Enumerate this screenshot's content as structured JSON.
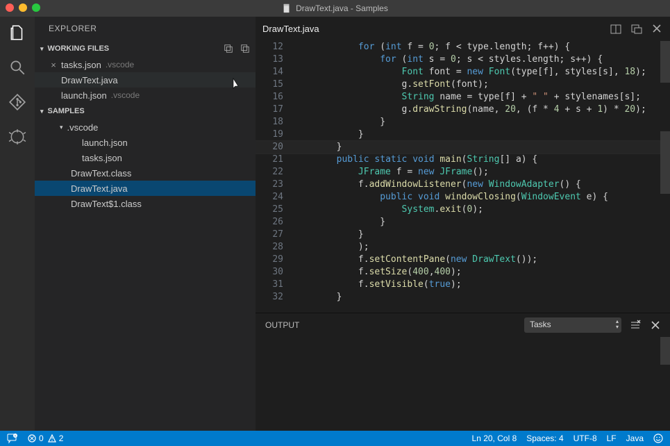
{
  "window": {
    "title": "DrawText.java - Samples"
  },
  "sidebar": {
    "title": "EXPLORER",
    "working_files_label": "WORKING FILES",
    "working_files": [
      {
        "name": "tasks.json",
        "meta": ".vscode",
        "close": true
      },
      {
        "name": "DrawText.java",
        "meta": "",
        "close": false
      },
      {
        "name": "launch.json",
        "meta": ".vscode",
        "close": false
      }
    ],
    "samples_label": "SAMPLES",
    "folder": ".vscode",
    "files_in_folder": [
      "launch.json",
      "tasks.json"
    ],
    "root_files": [
      "DrawText.class",
      "DrawText.java",
      "DrawText$1.class"
    ]
  },
  "editor": {
    "tab": "DrawText.java",
    "lines": [
      {
        "n": 12,
        "html": "            <span class='tok-kw'>for</span> (<span class='tok-kw'>int</span> f = <span class='tok-num'>0</span>; f &lt; type.length; f++) {"
      },
      {
        "n": 13,
        "html": "                <span class='tok-kw'>for</span> (<span class='tok-kw'>int</span> s = <span class='tok-num'>0</span>; s &lt; styles.length; s++) {"
      },
      {
        "n": 14,
        "html": "                    <span class='tok-type'>Font</span> font = <span class='tok-kw'>new</span> <span class='tok-type'>Font</span>(type[f], styles[s], <span class='tok-num'>18</span>);"
      },
      {
        "n": 15,
        "html": "                    g.<span class='tok-fn'>setFont</span>(font);"
      },
      {
        "n": 16,
        "html": "                    <span class='tok-type'>String</span> name = type[f] + <span class='tok-str'>\" \"</span> + stylenames[s];"
      },
      {
        "n": 17,
        "html": "                    g.<span class='tok-fn'>drawString</span>(name, <span class='tok-num'>20</span>, (f * <span class='tok-num'>4</span> + s + <span class='tok-num'>1</span>) * <span class='tok-num'>20</span>);"
      },
      {
        "n": 18,
        "html": "                }"
      },
      {
        "n": 19,
        "html": "            }"
      },
      {
        "n": 20,
        "html": "        }"
      },
      {
        "n": 21,
        "html": "        <span class='tok-kw'>public</span> <span class='tok-kw'>static</span> <span class='tok-kw'>void</span> <span class='tok-fn'>main</span>(<span class='tok-type'>String</span>[] a) {"
      },
      {
        "n": 22,
        "html": "            <span class='tok-type'>JFrame</span> f = <span class='tok-kw'>new</span> <span class='tok-type'>JFrame</span>();"
      },
      {
        "n": 23,
        "html": "            f.<span class='tok-fn'>addWindowListener</span>(<span class='tok-kw'>new</span> <span class='tok-type'>WindowAdapter</span>() {"
      },
      {
        "n": 24,
        "html": "                <span class='tok-kw'>public</span> <span class='tok-kw'>void</span> <span class='tok-fn'>windowClosing</span>(<span class='tok-type'>WindowEvent</span> e) {"
      },
      {
        "n": 25,
        "html": "                    <span class='tok-type'>System</span>.<span class='tok-fn'>exit</span>(<span class='tok-num'>0</span>);"
      },
      {
        "n": 26,
        "html": "                }"
      },
      {
        "n": 27,
        "html": "            }"
      },
      {
        "n": 28,
        "html": "            );"
      },
      {
        "n": 29,
        "html": "            f.<span class='tok-fn'>setContentPane</span>(<span class='tok-kw'>new</span> <span class='tok-type'>DrawText</span>());"
      },
      {
        "n": 30,
        "html": "            f.<span class='tok-fn'>setSize</span>(<span class='tok-num'>400</span>,<span class='tok-num'>400</span>);"
      },
      {
        "n": 31,
        "html": "            f.<span class='tok-fn'>setVisible</span>(<span class='tok-kw'>true</span>);"
      },
      {
        "n": 32,
        "html": "        }"
      }
    ]
  },
  "output": {
    "label": "OUTPUT",
    "dropdown": "Tasks"
  },
  "status": {
    "errors": "0",
    "warnings": "2",
    "ln_col": "Ln 20, Col 8",
    "spaces": "Spaces: 4",
    "encoding": "UTF-8",
    "eol": "LF",
    "lang": "Java"
  }
}
